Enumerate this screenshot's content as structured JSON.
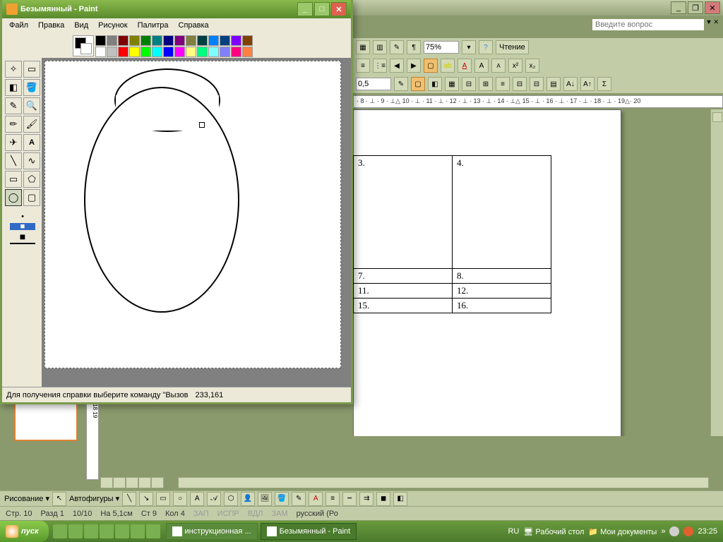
{
  "word": {
    "question_placeholder": "Введите вопрос",
    "zoom": "75%",
    "reading": "Чтение",
    "linewidth": "0,5",
    "ruler": "· 8 · ⊥ · 9 · ⊥△ 10 · ⊥ · 11 · ⊥ · 12 · ⊥ · 13 · ⊥ · 14 · ⊥△ 15 · ⊥ · 16 · ⊥ · 17 · ⊥ · 18 · ⊥ · 19△· 20",
    "table": {
      "r1": [
        "3.",
        "4."
      ],
      "r2": [
        "7.",
        "8."
      ],
      "r3": [
        "11.",
        "12."
      ],
      "r4": [
        "15.",
        "16."
      ]
    },
    "draw_label": "Рисование",
    "autoshapes": "Автофигуры",
    "status": {
      "page": "Стр. 10",
      "sect": "Разд 1",
      "pages": "10/10",
      "at": "На 5,1см",
      "line": "Ст 9",
      "col": "Кол 4",
      "zap": "ЗАП",
      "ispr": "ИСПР",
      "vdl": "ВДЛ",
      "zam": "ЗАМ",
      "lang": "русский (Ро"
    }
  },
  "paint": {
    "title": "Безымянный - Paint",
    "menu": {
      "file": "Файл",
      "edit": "Правка",
      "view": "Вид",
      "image": "Рисунок",
      "palette": "Палитра",
      "help": "Справка"
    },
    "status_help": "Для получения справки выберите команду \"Вызов",
    "coords": "233,161",
    "palette_colors": [
      "#000000",
      "#808080",
      "#800000",
      "#808000",
      "#008000",
      "#008080",
      "#000080",
      "#800080",
      "#808040",
      "#004040",
      "#0080ff",
      "#004080",
      "#8000ff",
      "#804000",
      "#ffffff",
      "#c0c0c0",
      "#ff0000",
      "#ffff00",
      "#00ff00",
      "#00ffff",
      "#0000ff",
      "#ff00ff",
      "#ffff80",
      "#00ff80",
      "#80ffff",
      "#8080ff",
      "#ff0080",
      "#ff8040"
    ]
  },
  "taskbar": {
    "start": "пуск",
    "items": [
      {
        "label": "инструкционная ...",
        "active": false
      },
      {
        "label": "Безымянный - Paint",
        "active": true
      }
    ],
    "lang": "RU",
    "desktop": "Рабочий стол",
    "docs": "Мои документы",
    "time": "23:25"
  }
}
